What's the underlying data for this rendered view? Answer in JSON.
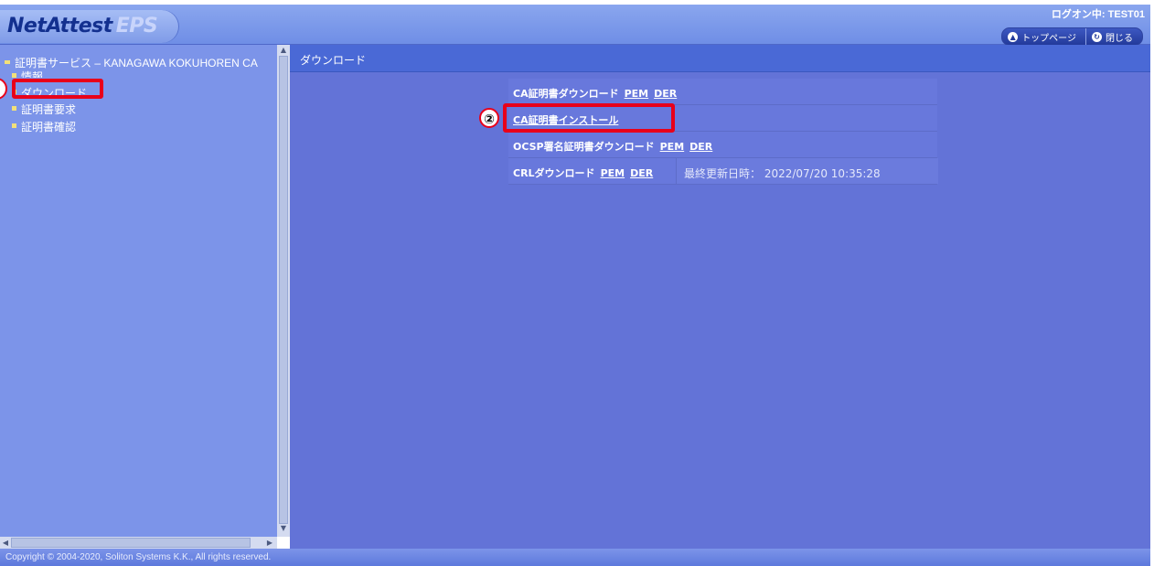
{
  "header": {
    "logo_main": "NetAttest",
    "logo_sub": "EPS",
    "logon_status": "ログオン中: TEST01",
    "buttons": [
      {
        "label": "トップページ",
        "icon": "up-arrow-icon"
      },
      {
        "label": "閉じる",
        "icon": "close-icon"
      }
    ]
  },
  "sidebar": {
    "root_label": "証明書サービス – KANAGAWA KOKUHOREN CA",
    "items": [
      {
        "label": "情報"
      },
      {
        "label": "ダウンロード"
      },
      {
        "label": "証明書要求"
      },
      {
        "label": "証明書確認"
      }
    ]
  },
  "main": {
    "title": "ダウンロード",
    "rows": [
      {
        "label": "CA証明書ダウンロード",
        "links": [
          "PEM",
          "DER"
        ]
      },
      {
        "label": "CA証明書インストール",
        "links": []
      },
      {
        "label": "OCSP署名証明書ダウンロード",
        "links": [
          "PEM",
          "DER"
        ]
      },
      {
        "label": "CRLダウンロード",
        "links": [
          "PEM",
          "DER"
        ],
        "meta": "最終更新日時： 2022/07/20 10:35:28"
      }
    ],
    "callout_number": "②"
  },
  "footer": {
    "copyright": "Copyright © 2004-2020, Soliton Systems K.K., All rights reserved."
  },
  "colors": {
    "header": "#7f9be8",
    "sidebar": "#7c94e9",
    "main": "#6373d7",
    "title_bar": "#4a69d6",
    "highlight": "#e8001a"
  }
}
